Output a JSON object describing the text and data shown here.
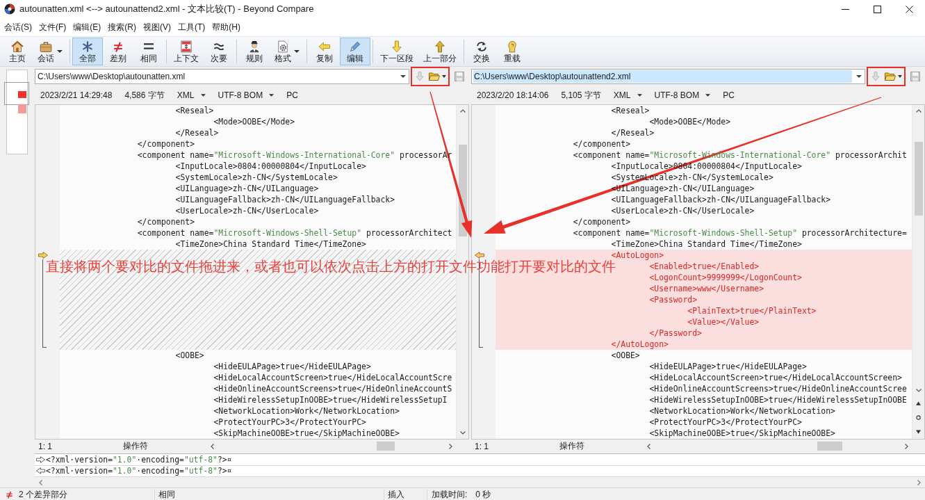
{
  "window": {
    "title": "autounatten.xml <--> autounattend2.xml - 文本比较(T) - Beyond Compare"
  },
  "menu": [
    "会话(S)",
    "文件(F)",
    "编辑(E)",
    "搜索(R)",
    "视图(V)",
    "工具(T)",
    "帮助(H)"
  ],
  "toolbar": {
    "groups": [
      [
        {
          "label": "主页",
          "selected": false,
          "dropdown": false
        },
        {
          "label": "会话",
          "selected": false,
          "dropdown": true
        }
      ],
      [
        {
          "label": "全部",
          "selected": true,
          "dropdown": false
        },
        {
          "label": "差别",
          "selected": false,
          "dropdown": false
        },
        {
          "label": "相同",
          "selected": false,
          "dropdown": false
        }
      ],
      [
        {
          "label": "上下文",
          "selected": false,
          "dropdown": false
        },
        {
          "label": "次要",
          "selected": false,
          "dropdown": false
        }
      ],
      [
        {
          "label": "规则",
          "selected": false,
          "dropdown": false
        },
        {
          "label": "格式",
          "selected": false,
          "dropdown": true
        }
      ],
      [
        {
          "label": "复制",
          "selected": false,
          "dropdown": false
        },
        {
          "label": "编辑",
          "selected": true,
          "dropdown": false
        }
      ],
      [
        {
          "label": "下一区段",
          "selected": false,
          "dropdown": false
        },
        {
          "label": "上一部分",
          "selected": false,
          "dropdown": false
        }
      ],
      [
        {
          "label": "交换",
          "selected": false,
          "dropdown": false
        },
        {
          "label": "重载",
          "selected": false,
          "dropdown": false
        }
      ]
    ]
  },
  "panes": [
    {
      "path": "C:\\Users\\www\\Desktop\\autounatten.xml",
      "selected": false,
      "actions": [
        {
          "kind": "history",
          "disabled": true,
          "dropdown": false
        },
        {
          "kind": "open",
          "disabled": false,
          "dropdown": true
        },
        {
          "kind": "save",
          "disabled": true,
          "dropdown": false
        }
      ],
      "info": {
        "modified": "2023/2/21 14:29:48",
        "size": "4,586 字节",
        "format": "XML",
        "encoding": "UTF-8 BOM",
        "line_endings": "PC"
      },
      "lines": [
        {
          "kind": "same",
          "text": "\t\t\t<Reseal>"
        },
        {
          "kind": "same",
          "text": "\t\t\t\t<Mode>OOBE</Mode>"
        },
        {
          "kind": "same",
          "text": "\t\t\t</Reseal>"
        },
        {
          "kind": "same",
          "text": "\t\t</component>"
        },
        {
          "kind": "same",
          "text": "\t\t<component name=\"Microsoft-Windows-International-Core\" processorAr"
        },
        {
          "kind": "same",
          "text": "\t\t\t<InputLocale>0804:00000804</InputLocale>"
        },
        {
          "kind": "same",
          "text": "\t\t\t<SystemLocale>zh-CN</SystemLocale>"
        },
        {
          "kind": "same",
          "text": "\t\t\t<UILanguage>zh-CN</UILanguage>"
        },
        {
          "kind": "same",
          "text": "\t\t\t<UILanguageFallback>zh-CN</UILanguageFallback>"
        },
        {
          "kind": "same",
          "text": "\t\t\t<UserLocale>zh-CN</UserLocale>"
        },
        {
          "kind": "same",
          "text": "\t\t</component>"
        },
        {
          "kind": "same",
          "text": "\t\t<component name=\"Microsoft-Windows-Shell-Setup\" processorArchitect"
        },
        {
          "kind": "same",
          "text": "\t\t\t<TimeZone>China Standard Time</TimeZone>"
        },
        {
          "kind": "gap"
        },
        {
          "kind": "gap"
        },
        {
          "kind": "gap"
        },
        {
          "kind": "gap"
        },
        {
          "kind": "gap"
        },
        {
          "kind": "gap"
        },
        {
          "kind": "gap"
        },
        {
          "kind": "gap"
        },
        {
          "kind": "gap"
        },
        {
          "kind": "same",
          "text": "\t\t\t<OOBE>"
        },
        {
          "kind": "same",
          "text": "\t\t\t\t<HideEULAPage>true</HideEULAPage>"
        },
        {
          "kind": "same",
          "text": "\t\t\t\t<HideLocalAccountScreen>true</HideLocalAccountScre"
        },
        {
          "kind": "same",
          "text": "\t\t\t\t<HideOnlineAccountScreens>true</HideOnlineAccountS"
        },
        {
          "kind": "same",
          "text": "\t\t\t\t<HideWirelessSetupInOOBE>true</HideWirelessSetupI"
        },
        {
          "kind": "same",
          "text": "\t\t\t\t<NetworkLocation>Work</NetworkLocation>"
        },
        {
          "kind": "same",
          "text": "\t\t\t\t<ProtectYourPC>3</ProtectYourPC>"
        },
        {
          "kind": "same",
          "text": "\t\t\t\t<SkipMachineOOBE>true</SkipMachineOOBE>"
        }
      ],
      "cursor": "1: 1",
      "mode": "操作符"
    },
    {
      "path": "C:\\Users\\www\\Desktop\\autounattend2.xml",
      "selected": true,
      "actions": [
        {
          "kind": "history",
          "disabled": true,
          "dropdown": false
        },
        {
          "kind": "open",
          "disabled": false,
          "dropdown": true
        },
        {
          "kind": "save",
          "disabled": true,
          "dropdown": false
        }
      ],
      "info": {
        "modified": "2023/2/20 18:14:06",
        "size": "5,105 字节",
        "format": "XML",
        "encoding": "UTF-8 BOM",
        "line_endings": "PC"
      },
      "lines": [
        {
          "kind": "same",
          "text": "\t\t\t<Reseal>"
        },
        {
          "kind": "same",
          "text": "\t\t\t\t<Mode>OOBE</Mode>"
        },
        {
          "kind": "same",
          "text": "\t\t\t</Reseal>"
        },
        {
          "kind": "same",
          "text": "\t\t</component>"
        },
        {
          "kind": "same",
          "text": "\t\t<component name=\"Microsoft-Windows-International-Core\" processorArchit"
        },
        {
          "kind": "same",
          "text": "\t\t\t<InputLocale>0804:00000804</InputLocale>"
        },
        {
          "kind": "same",
          "text": "\t\t\t<SystemLocale>zh-CN</SystemLocale>"
        },
        {
          "kind": "same",
          "text": "\t\t\t<UILanguage>zh-CN</UILanguage>"
        },
        {
          "kind": "same",
          "text": "\t\t\t<UILanguageFallback>zh-CN</UILanguageFallback>"
        },
        {
          "kind": "same",
          "text": "\t\t\t<UserLocale>zh-CN</UserLocale>"
        },
        {
          "kind": "same",
          "text": "\t\t</component>"
        },
        {
          "kind": "same",
          "text": "\t\t<component name=\"Microsoft-Windows-Shell-Setup\" processorArchitecture="
        },
        {
          "kind": "same",
          "text": "\t\t\t<TimeZone>China Standard Time</TimeZone>"
        },
        {
          "kind": "added",
          "text": "\t\t\t<AutoLogon>"
        },
        {
          "kind": "added",
          "text": "\t\t\t\t<Enabled>true</Enabled>"
        },
        {
          "kind": "added",
          "text": "\t\t\t\t<LogonCount>9999999</LogonCount>"
        },
        {
          "kind": "added",
          "text": "\t\t\t\t<Username>www</Username>"
        },
        {
          "kind": "added",
          "text": "\t\t\t\t<Password>"
        },
        {
          "kind": "added",
          "text": "\t\t\t\t\t<PlainText>true</PlainText>"
        },
        {
          "kind": "added",
          "text": "\t\t\t\t\t<Value></Value>"
        },
        {
          "kind": "added",
          "text": "\t\t\t\t</Password>"
        },
        {
          "kind": "added",
          "text": "\t\t\t</AutoLogon>"
        },
        {
          "kind": "same",
          "text": "\t\t\t<OOBE>"
        },
        {
          "kind": "same",
          "text": "\t\t\t\t<HideEULAPage>true</HideEULAPage>"
        },
        {
          "kind": "same",
          "text": "\t\t\t\t<HideLocalAccountScreen>true</HideLocalAccountScreen>"
        },
        {
          "kind": "same",
          "text": "\t\t\t\t<HideOnlineAccountScreens>true</HideOnlineAccountScree"
        },
        {
          "kind": "same",
          "text": "\t\t\t\t<HideWirelessSetupInOOBE>true</HideWirelessSetupInOOBE"
        },
        {
          "kind": "same",
          "text": "\t\t\t\t<NetworkLocation>Work</NetworkLocation>"
        },
        {
          "kind": "same",
          "text": "\t\t\t\t<ProtectYourPC>3</ProtectYourPC>"
        },
        {
          "kind": "same",
          "text": "\t\t\t\t<SkipMachineOOBE>true</SkipMachineOOBE>"
        }
      ],
      "cursor": "1: 1",
      "mode": "操作符"
    }
  ],
  "line_details": [
    {
      "text": "<?xml·version=\"1.0\"·encoding=\"utf-8\"?>¤"
    },
    {
      "text": "<?xml·version=\"1.0\"·encoding=\"utf-8\"?>¤"
    }
  ],
  "status_bar": {
    "differences": "2 个差异部分",
    "view_filter": "相同",
    "edit_mode": "插入",
    "load_time_label": "加载时间:",
    "load_time": "0 秒"
  },
  "annotation": {
    "text": "直接将两个要对比的文件拖进来，或者也可以依次点击上方的打开文件功能打开要对比的文件"
  }
}
